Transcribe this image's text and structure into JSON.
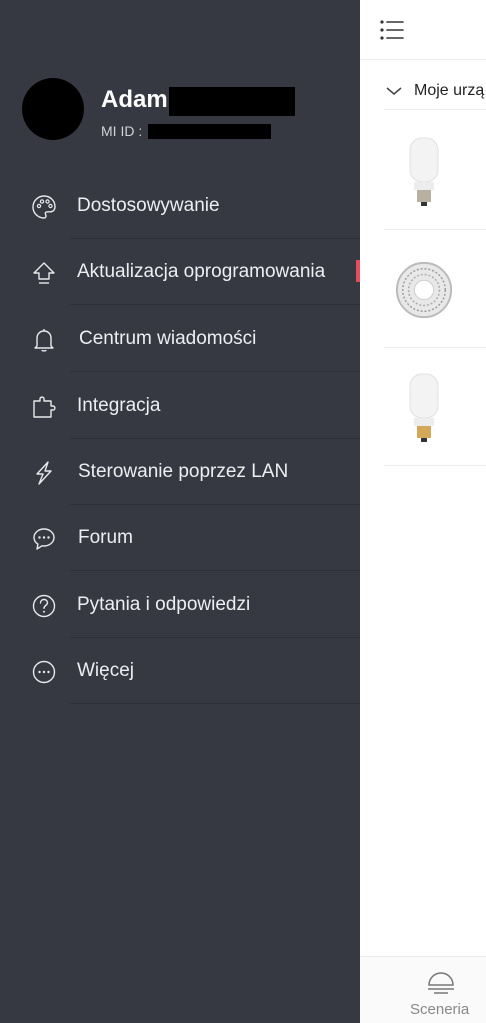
{
  "main": {
    "section_title": "Moje urzą",
    "bottom_nav": {
      "scenes_label": "Sceneria"
    },
    "devices": [
      {
        "icon": "bulb-icon"
      },
      {
        "icon": "led-strip-icon"
      },
      {
        "icon": "bulb-icon"
      }
    ]
  },
  "drawer": {
    "profile": {
      "name": "Adam",
      "mi_id_label": "MI ID :"
    },
    "items": [
      {
        "label": "Dostosowywanie",
        "icon": "palette-icon"
      },
      {
        "label": "Aktualizacja oprogramowania",
        "icon": "upload-arrow-icon"
      },
      {
        "label": "Centrum wiadomości",
        "icon": "bell-icon"
      },
      {
        "label": "Integracja",
        "icon": "puzzle-icon"
      },
      {
        "label": "Sterowanie poprzez LAN",
        "icon": "lightning-icon"
      },
      {
        "label": "Forum",
        "icon": "chat-bubble-icon"
      },
      {
        "label": "Pytania i odpowiedzi",
        "icon": "question-icon"
      },
      {
        "label": "Więcej",
        "icon": "more-icon"
      }
    ]
  },
  "colors": {
    "drawer_bg": "#363941",
    "badge_red": "#e64d59",
    "text_light": "#eceef2"
  }
}
